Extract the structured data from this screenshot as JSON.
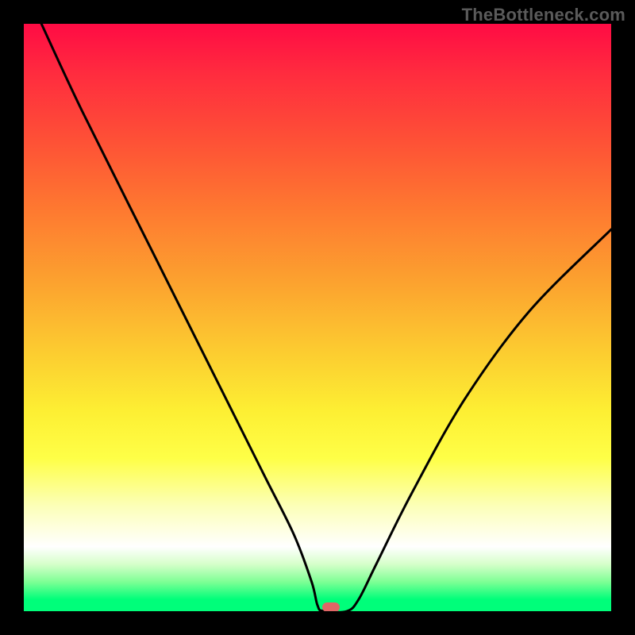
{
  "watermark": "TheBottleneck.com",
  "chart_data": {
    "type": "line",
    "title": "",
    "xlabel": "",
    "ylabel": "",
    "xlim": [
      0,
      100
    ],
    "ylim": [
      0,
      100
    ],
    "grid": false,
    "series": [
      {
        "name": "bottleneck-curve",
        "x": [
          3,
          10,
          22,
          34,
          41,
          46,
          49,
          50,
          51,
          55,
          57,
          60,
          66,
          75,
          86,
          100
        ],
        "values": [
          100,
          85,
          61,
          37,
          23,
          13,
          5,
          1,
          0,
          0,
          2,
          8,
          20,
          36,
          51,
          65
        ]
      }
    ],
    "annotations": [
      {
        "name": "min-marker",
        "x": 52.3,
        "y": 0.7,
        "color": "#e06666"
      }
    ],
    "background_gradient_stops": [
      {
        "pos": 0,
        "color": "#ff0b44"
      },
      {
        "pos": 8,
        "color": "#ff2a3f"
      },
      {
        "pos": 20,
        "color": "#fe5136"
      },
      {
        "pos": 32,
        "color": "#fe7a30"
      },
      {
        "pos": 44,
        "color": "#fca22f"
      },
      {
        "pos": 55,
        "color": "#fcc930"
      },
      {
        "pos": 66,
        "color": "#fdef33"
      },
      {
        "pos": 74,
        "color": "#feff47"
      },
      {
        "pos": 82,
        "color": "#fcffb7"
      },
      {
        "pos": 89,
        "color": "#ffffff"
      },
      {
        "pos": 92,
        "color": "#d6ffca"
      },
      {
        "pos": 95,
        "color": "#7eff95"
      },
      {
        "pos": 98,
        "color": "#00fe7a"
      },
      {
        "pos": 100,
        "color": "#00fe7a"
      }
    ]
  }
}
